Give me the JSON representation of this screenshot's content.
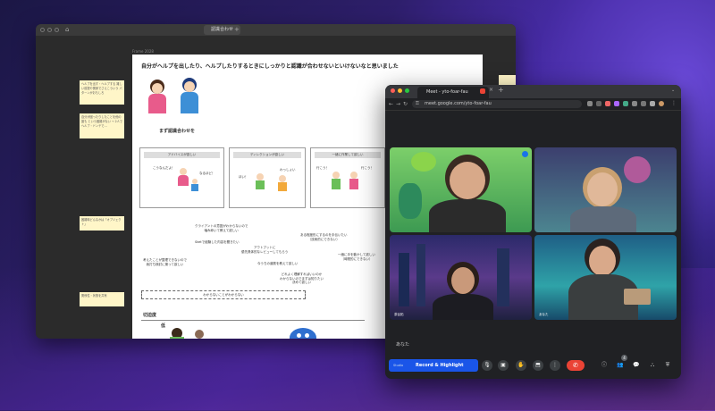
{
  "whiteboard": {
    "tab_title": "認識合わせ",
    "plus": "+",
    "frame_label": "Frame 2028",
    "heading": "自分がヘルプを出したり、ヘルプしたりするときにしっかりと認識が合わせないといけないなと思いました",
    "subheading": "まず認識合わせを",
    "boxes": [
      {
        "head": "アドバイスが欲しい",
        "line1": "こうなんだよ！",
        "line2": "なるほど！"
      },
      {
        "head": "ディレクションが欲しい",
        "line1": "ほい！",
        "line2": "わっしょい"
      },
      {
        "head": "一緒に作業して欲しい",
        "line1": "行こう！",
        "line2": "行こう！"
      }
    ],
    "notes": [
      "クライアントの意図がわからないので\n噛み砕いて教えて欲しい",
      "Sketで経験した内容を聞きたい",
      "アウトプットに\n優先具体的なレビューしてもらう",
      "ある程度形にするのを手伝いたい\n（技術的にできない）",
      "考えたことが整理できないので\n我打ち検討に乗って欲しい",
      "今うちの道筋を教えて欲しい",
      "一緒に手を動かして欲しい\n（時間的にできない）",
      "どれよく理解すればいいのか\nわからないのでまずは知りたい\n決めて欲しい"
    ],
    "dashed_text": "わからないことがわからない",
    "section2": "切迫度",
    "low_label": "低",
    "stickies": [
      "ヘルプを出す・ヘルプする\n難しい前提や関係でさえこういう\nパターンがおもしろ",
      "自分が困ったりしたことを他の誰も\nという困難がない\n→ 2人でヘルプ・ドンテで…",
      "困難時どんなかは「オブジェクト」",
      "関係性・状態を共有"
    ]
  },
  "meet": {
    "tab_title": "Meet - yto-foar-fau",
    "url": "meet.google.com/yto-foar-fau",
    "participants": [
      {
        "name": ""
      },
      {
        "name": ""
      },
      {
        "name": "茶谷拓"
      },
      {
        "name": "あなた"
      }
    ],
    "self_label": "あなた",
    "record_tag": "Studio",
    "record_label": "Record & Highlight",
    "badge_count": "4"
  },
  "colors": {
    "meet_bg": "#202124",
    "record_blue": "#1a55e8",
    "end_red": "#ea4335",
    "sticky_yellow": "#fff6c8"
  }
}
